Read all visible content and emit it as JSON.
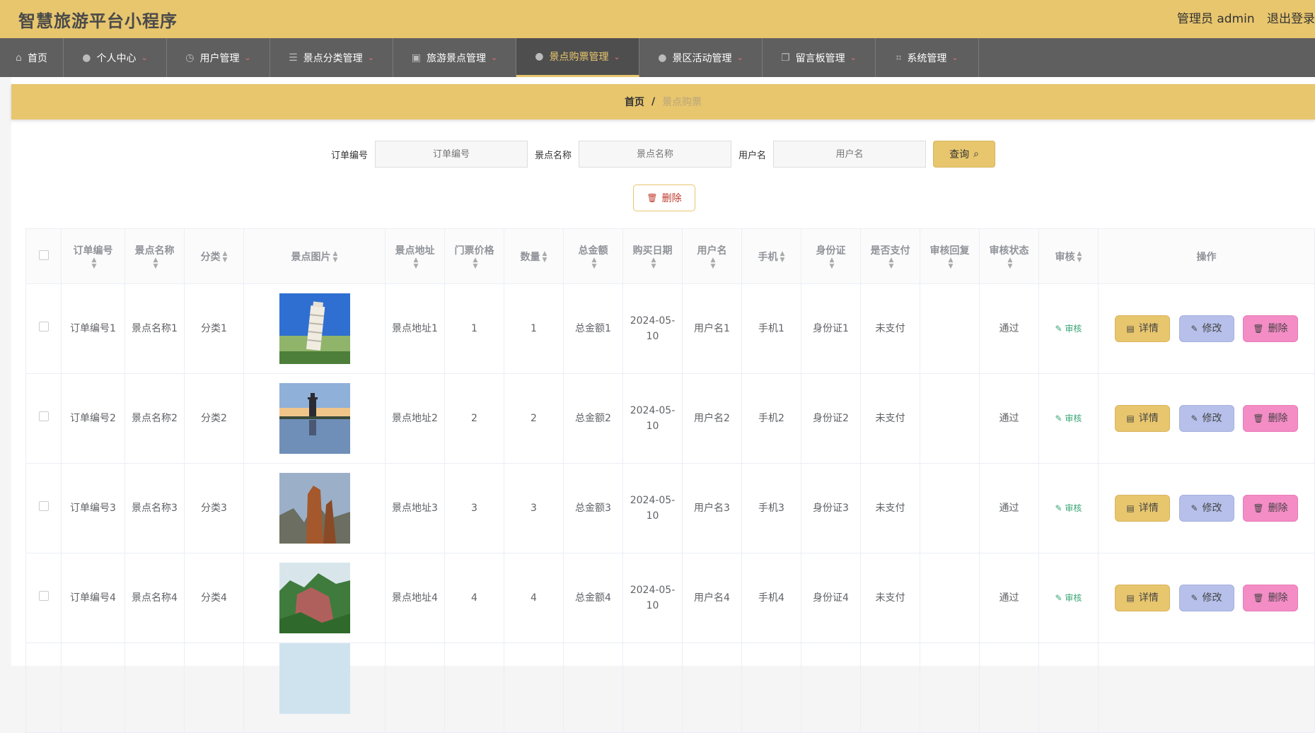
{
  "app": {
    "title": "智慧旅游平台小程序"
  },
  "header": {
    "user_label": "管理员 admin",
    "logout_label": "退出登录"
  },
  "nav": [
    {
      "label": "首页",
      "icon": "home-icon",
      "glyph": "⌂",
      "chevron": ""
    },
    {
      "label": "个人中心",
      "icon": "user-icon",
      "glyph": "●",
      "chevron": "⌄"
    },
    {
      "label": "用户管理",
      "icon": "clock-icon",
      "glyph": "◷",
      "chevron": "⌄"
    },
    {
      "label": "景点分类管理",
      "icon": "list-icon",
      "glyph": "☰",
      "chevron": "⌄"
    },
    {
      "label": "旅游景点管理",
      "icon": "clipboard-icon",
      "glyph": "▣",
      "chevron": "⌄"
    },
    {
      "label": "景点购票管理",
      "icon": "user-icon",
      "glyph": "●",
      "chevron": "⌄"
    },
    {
      "label": "景区活动管理",
      "icon": "user-icon",
      "glyph": "●",
      "chevron": "⌄"
    },
    {
      "label": "留言板管理",
      "icon": "copy-icon",
      "glyph": "❐",
      "chevron": "⌄"
    },
    {
      "label": "系统管理",
      "icon": "crop-icon",
      "glyph": "⌗",
      "chevron": "⌄"
    }
  ],
  "breadcrumb": {
    "home": "首页",
    "separator": "/",
    "current": "景点购票"
  },
  "search": {
    "fields": [
      {
        "label": "订单编号",
        "placeholder": "订单编号"
      },
      {
        "label": "景点名称",
        "placeholder": "景点名称"
      },
      {
        "label": "用户名",
        "placeholder": "用户名"
      }
    ],
    "query_label": "查询"
  },
  "actions": {
    "delete_label": "删除"
  },
  "table": {
    "headers": [
      "订单编号",
      "景点名称",
      "分类",
      "景点图片",
      "景点地址",
      "门票价格",
      "数量",
      "总金额",
      "购买日期",
      "用户名",
      "手机",
      "身份证",
      "是否支付",
      "审核回复",
      "审核状态",
      "审核",
      "操作"
    ],
    "rows": [
      {
        "order": "订单编号1",
        "name": "景点名称1",
        "category": "分类1",
        "image": "leaning-tower",
        "address": "景点地址1",
        "price": "1",
        "qty": "1",
        "total": "总金额1",
        "date": "2024-05-10",
        "user": "用户名1",
        "phone": "手机1",
        "id_card": "身份证1",
        "paid": "未支付",
        "reply": "",
        "status": "通过"
      },
      {
        "order": "订单编号2",
        "name": "景点名称2",
        "category": "分类2",
        "image": "pagoda-lake",
        "address": "景点地址2",
        "price": "2",
        "qty": "2",
        "total": "总金额2",
        "date": "2024-05-10",
        "user": "用户名2",
        "phone": "手机2",
        "id_card": "身份证2",
        "paid": "未支付",
        "reply": "",
        "status": "通过"
      },
      {
        "order": "订单编号3",
        "name": "景点名称3",
        "category": "分类3",
        "image": "rock-peaks",
        "address": "景点地址3",
        "price": "3",
        "qty": "3",
        "total": "总金额3",
        "date": "2024-05-10",
        "user": "用户名3",
        "phone": "手机3",
        "id_card": "身份证3",
        "paid": "未支付",
        "reply": "",
        "status": "通过"
      },
      {
        "order": "订单编号4",
        "name": "景点名称4",
        "category": "分类4",
        "image": "green-mountain",
        "address": "景点地址4",
        "price": "4",
        "qty": "4",
        "total": "总金额4",
        "date": "2024-05-10",
        "user": "用户名4",
        "phone": "手机4",
        "id_card": "身份证4",
        "paid": "未支付",
        "reply": "",
        "status": "通过"
      }
    ],
    "audit_label": "审核",
    "detail_label": "详情",
    "edit_label": "修改",
    "delete_label": "删除"
  },
  "colors": {
    "accent": "#e8c66e",
    "nav_bg": "#5f5f5f",
    "edit": "#b6c0ea",
    "delete": "#f48cc5",
    "audit": "#3aa576"
  }
}
